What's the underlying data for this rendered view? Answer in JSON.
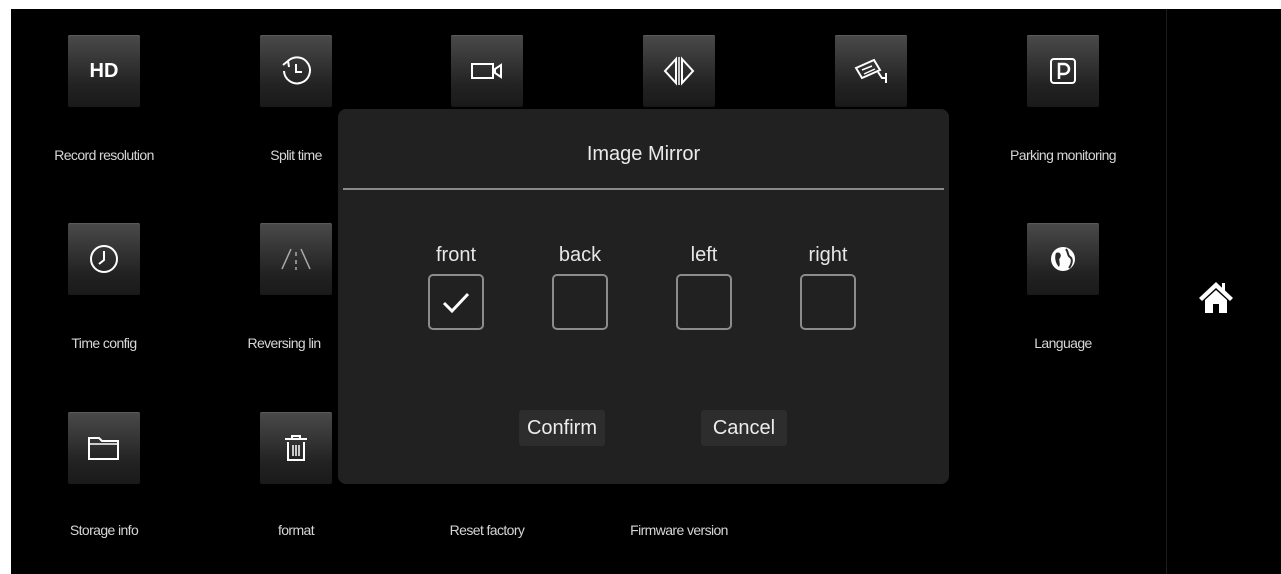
{
  "settings": {
    "items": [
      {
        "label": "Record resolution",
        "icon": "hd-icon",
        "text": "HD"
      },
      {
        "label": "Split time",
        "icon": "clock-icon"
      },
      {
        "label": "",
        "icon": "video-camera-icon"
      },
      {
        "label": "",
        "icon": "mirror-icon"
      },
      {
        "label": "",
        "icon": "surveillance-camera-icon"
      },
      {
        "label": "Parking monitoring",
        "icon": "parking-icon"
      },
      {
        "label": "Time config",
        "icon": "time-icon"
      },
      {
        "label": "Reversing lin",
        "icon": "reversing-line-icon"
      },
      {
        "label": "Language",
        "icon": "globe-icon"
      },
      {
        "label": "Storage info",
        "icon": "folder-icon"
      },
      {
        "label": "format",
        "icon": "trash-icon"
      },
      {
        "label": "Reset factory",
        "icon": "reset-icon"
      },
      {
        "label": "Firmware version",
        "icon": "firmware-icon"
      }
    ]
  },
  "sidebar": {
    "home_icon": "home-icon"
  },
  "dialog": {
    "title": "Image Mirror",
    "options": [
      {
        "label": "front",
        "checked": true
      },
      {
        "label": "back",
        "checked": false
      },
      {
        "label": "left",
        "checked": false
      },
      {
        "label": "right",
        "checked": false
      }
    ],
    "confirm_label": "Confirm",
    "cancel_label": "Cancel"
  },
  "colors": {
    "background": "#000000",
    "tile": "#2a2a2a",
    "dialog": "#212121",
    "text": "#e6e6e6"
  }
}
